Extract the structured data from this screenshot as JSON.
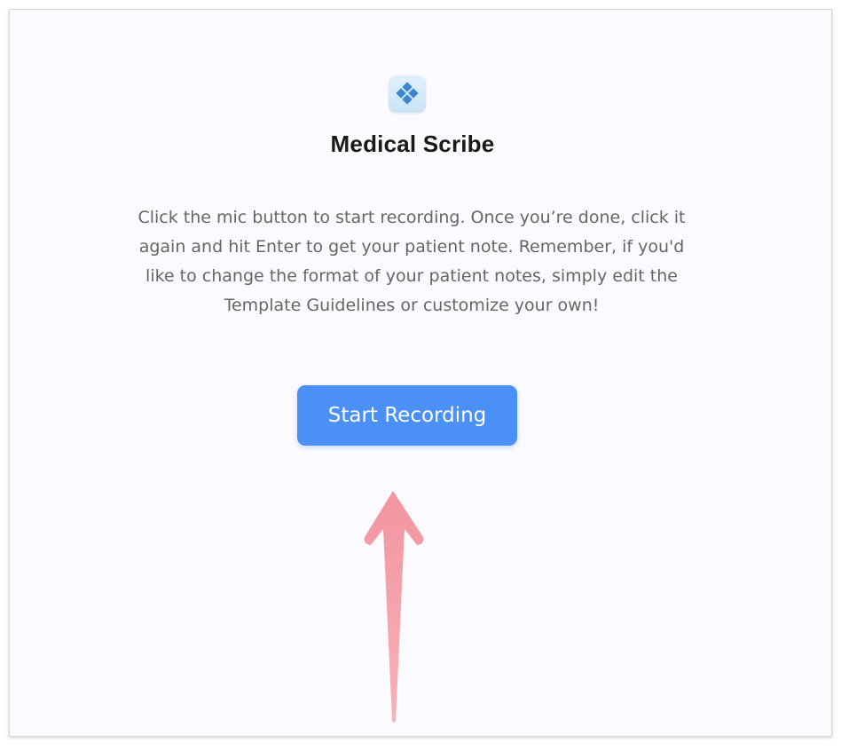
{
  "app": {
    "icon": "diamond-grid-icon",
    "title": "Medical Scribe",
    "description": "Click the mic button to start recording. Once you’re done, click it again and hit Enter to get your patient note. Remember, if you'd like to change the format of your patient notes, simply edit the Template Guidelines or customize your own!"
  },
  "actions": {
    "start_recording_label": "Start Recording"
  },
  "annotation": {
    "icon": "arrow-up-icon",
    "color": "#f4a0a8"
  },
  "colors": {
    "background": "#fbfaff",
    "accent": "#4a90f7",
    "icon_tile": "#d4eaf8",
    "icon_glyph": "#3b86cf"
  }
}
